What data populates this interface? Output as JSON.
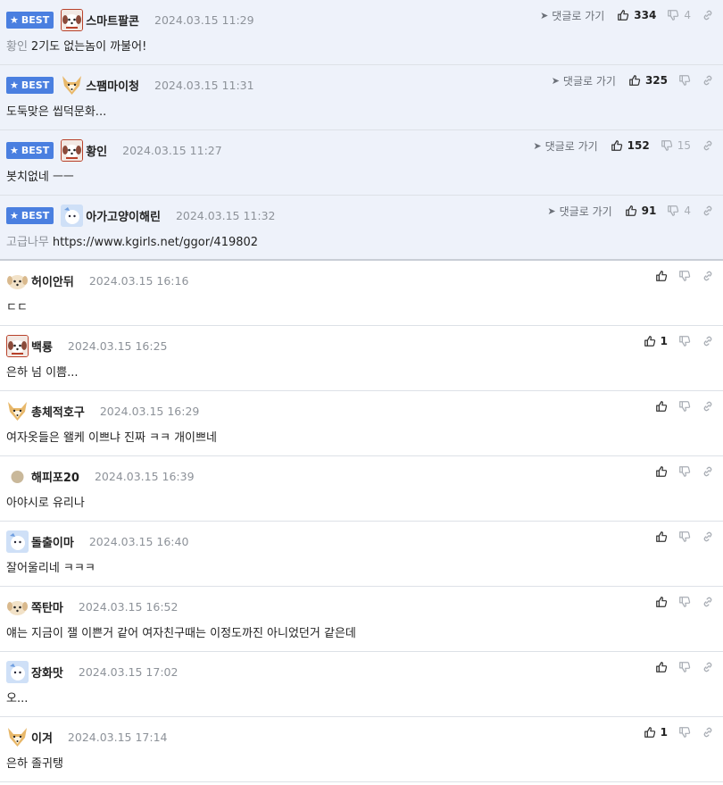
{
  "best_label": "BEST",
  "goto_label": "댓글로 가기",
  "comments": [
    {
      "best": true,
      "avatar": "dog-red",
      "nick": "스마트팔콘",
      "date": "2024.03.15 11:29",
      "prefix": "황인",
      "text": "2기도 없는놈이 까불어!",
      "up": "334",
      "down": "4"
    },
    {
      "best": true,
      "avatar": "fox",
      "nick": "스팸마이청",
      "date": "2024.03.15 11:31",
      "prefix": "",
      "text": "도둑맞은 씹덕문화...",
      "up": "325",
      "down": ""
    },
    {
      "best": true,
      "avatar": "dog-red",
      "nick": "황인",
      "date": "2024.03.15 11:27",
      "prefix": "",
      "text": "봇치없네 ㅡㅡ",
      "up": "152",
      "down": "15"
    },
    {
      "best": true,
      "avatar": "blue",
      "nick": "아가고양이해린",
      "date": "2024.03.15 11:32",
      "prefix": "고급나무",
      "text": "https://www.kgirls.net/ggor/419802",
      "up": "91",
      "down": "4"
    },
    {
      "best": false,
      "avatar": "dog-small",
      "nick": "허이안뒤",
      "date": "2024.03.15 16:16",
      "prefix": "",
      "text": "ㄷㄷ",
      "up": "",
      "down": ""
    },
    {
      "best": false,
      "avatar": "dog-red",
      "nick": "백룡",
      "date": "2024.03.15 16:25",
      "prefix": "",
      "text": "은하 넘 이쁨...",
      "up": "1",
      "down": ""
    },
    {
      "best": false,
      "avatar": "fox",
      "nick": "총체적호구",
      "date": "2024.03.15 16:29",
      "prefix": "",
      "text": "여자옷들은 왤케 이쁘냐 진짜 ㅋㅋ 개이쁘네",
      "up": "",
      "down": ""
    },
    {
      "best": false,
      "avatar": "circle",
      "nick": "해피포20",
      "date": "2024.03.15 16:39",
      "prefix": "",
      "text": "아야시로 유리나",
      "up": "",
      "down": ""
    },
    {
      "best": false,
      "avatar": "blue",
      "nick": "돌출이마",
      "date": "2024.03.15 16:40",
      "prefix": "",
      "text": "잘어울리네 ㅋㅋㅋ",
      "up": "",
      "down": ""
    },
    {
      "best": false,
      "avatar": "dog-small",
      "nick": "쪽탄마",
      "date": "2024.03.15 16:52",
      "prefix": "",
      "text": "얘는 지금이 잴 이쁜거 같어 여자친구때는 이정도까진 아니었던거 같은데",
      "up": "",
      "down": ""
    },
    {
      "best": false,
      "avatar": "blue",
      "nick": "장화맛",
      "date": "2024.03.15 17:02",
      "prefix": "",
      "text": "오...",
      "up": "",
      "down": ""
    },
    {
      "best": false,
      "avatar": "fox",
      "nick": "이겨",
      "date": "2024.03.15 17:14",
      "prefix": "",
      "text": "은하 졸귀탱",
      "up": "1",
      "down": ""
    }
  ],
  "colors": {
    "best_bg": "#eef2fa",
    "badge": "#4a7fe0",
    "date": "#8d9299",
    "border": "#dde1e7"
  },
  "icons": {
    "best": "star-icon",
    "goto": "send-arrow-icon",
    "up": "thumbs-up-icon",
    "down": "thumbs-down-icon",
    "link": "link-icon"
  }
}
